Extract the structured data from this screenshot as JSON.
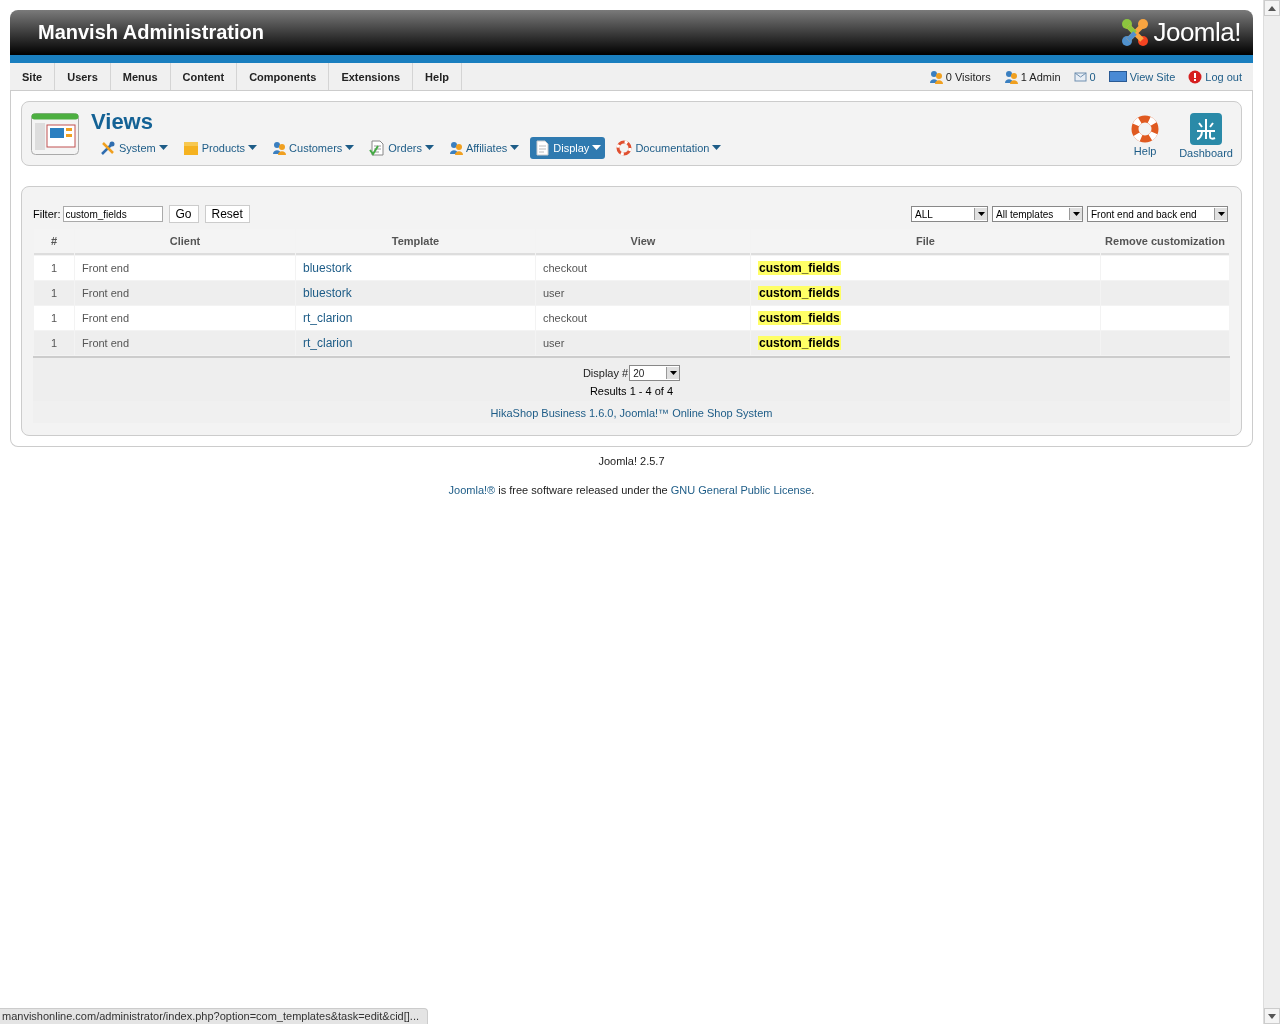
{
  "header": {
    "title": "Manvish Administration",
    "logo_text": "Joomla!"
  },
  "menu": {
    "items": [
      {
        "label": "Site"
      },
      {
        "label": "Users"
      },
      {
        "label": "Menus"
      },
      {
        "label": "Content"
      },
      {
        "label": "Components"
      },
      {
        "label": "Extensions"
      },
      {
        "label": "Help"
      }
    ],
    "status": [
      {
        "kind": "count",
        "label": "0 Visitors"
      },
      {
        "kind": "count",
        "label": "1 Admin"
      },
      {
        "kind": "link",
        "label": "0"
      },
      {
        "kind": "link",
        "label": "View Site"
      },
      {
        "kind": "link",
        "label": "Log out"
      }
    ]
  },
  "toolbar": {
    "title": "Views",
    "submenu": [
      {
        "label": "System",
        "selected": false
      },
      {
        "label": "Products",
        "selected": false
      },
      {
        "label": "Customers",
        "selected": false
      },
      {
        "label": "Orders",
        "selected": false
      },
      {
        "label": "Affiliates",
        "selected": false
      },
      {
        "label": "Display",
        "selected": true
      },
      {
        "label": "Documentation",
        "selected": false
      }
    ],
    "buttons": [
      {
        "label": "Help"
      },
      {
        "label": "Dashboard"
      }
    ]
  },
  "filter": {
    "label": "Filter:",
    "value": "custom_fields",
    "buttons": [
      "Go",
      "Reset"
    ],
    "selects": [
      {
        "value": "ALL"
      },
      {
        "value": "All templates"
      },
      {
        "value": "Front end and back end"
      }
    ]
  },
  "table": {
    "columns": [
      "#",
      "Client",
      "Template",
      "View",
      "File",
      "Remove customization"
    ],
    "rows": [
      {
        "number": "1",
        "client": "Front end",
        "template": "bluestork",
        "view": "checkout",
        "file": "custom_fields",
        "highlighted": true
      },
      {
        "number": "1",
        "client": "Front end",
        "template": "bluestork",
        "view": "user",
        "file": "custom_fields",
        "highlighted": true
      },
      {
        "number": "1",
        "client": "Front end",
        "template": "rt_clarion",
        "view": "checkout",
        "file": "custom_fields",
        "highlighted": true
      },
      {
        "number": "1",
        "client": "Front end",
        "template": "rt_clarion",
        "view": "user",
        "file": "custom_fields",
        "highlighted": true
      }
    ]
  },
  "pagination": {
    "display_label": "Display #",
    "display_value": "20",
    "results": "Results 1 - 4 of 4"
  },
  "credit": "HikaShop Business 1.6.0, Joomla!™ Online Shop System",
  "footer": {
    "version": "Joomla! 2.5.7",
    "license_link1": "Joomla!®",
    "license_text": "is free software released under the",
    "license_link2": "GNU General Public License",
    "license_end": "."
  },
  "status_bar": "manvishonline.com/administrator/index.php?option=com_templates&task=edit&cid[]..."
}
